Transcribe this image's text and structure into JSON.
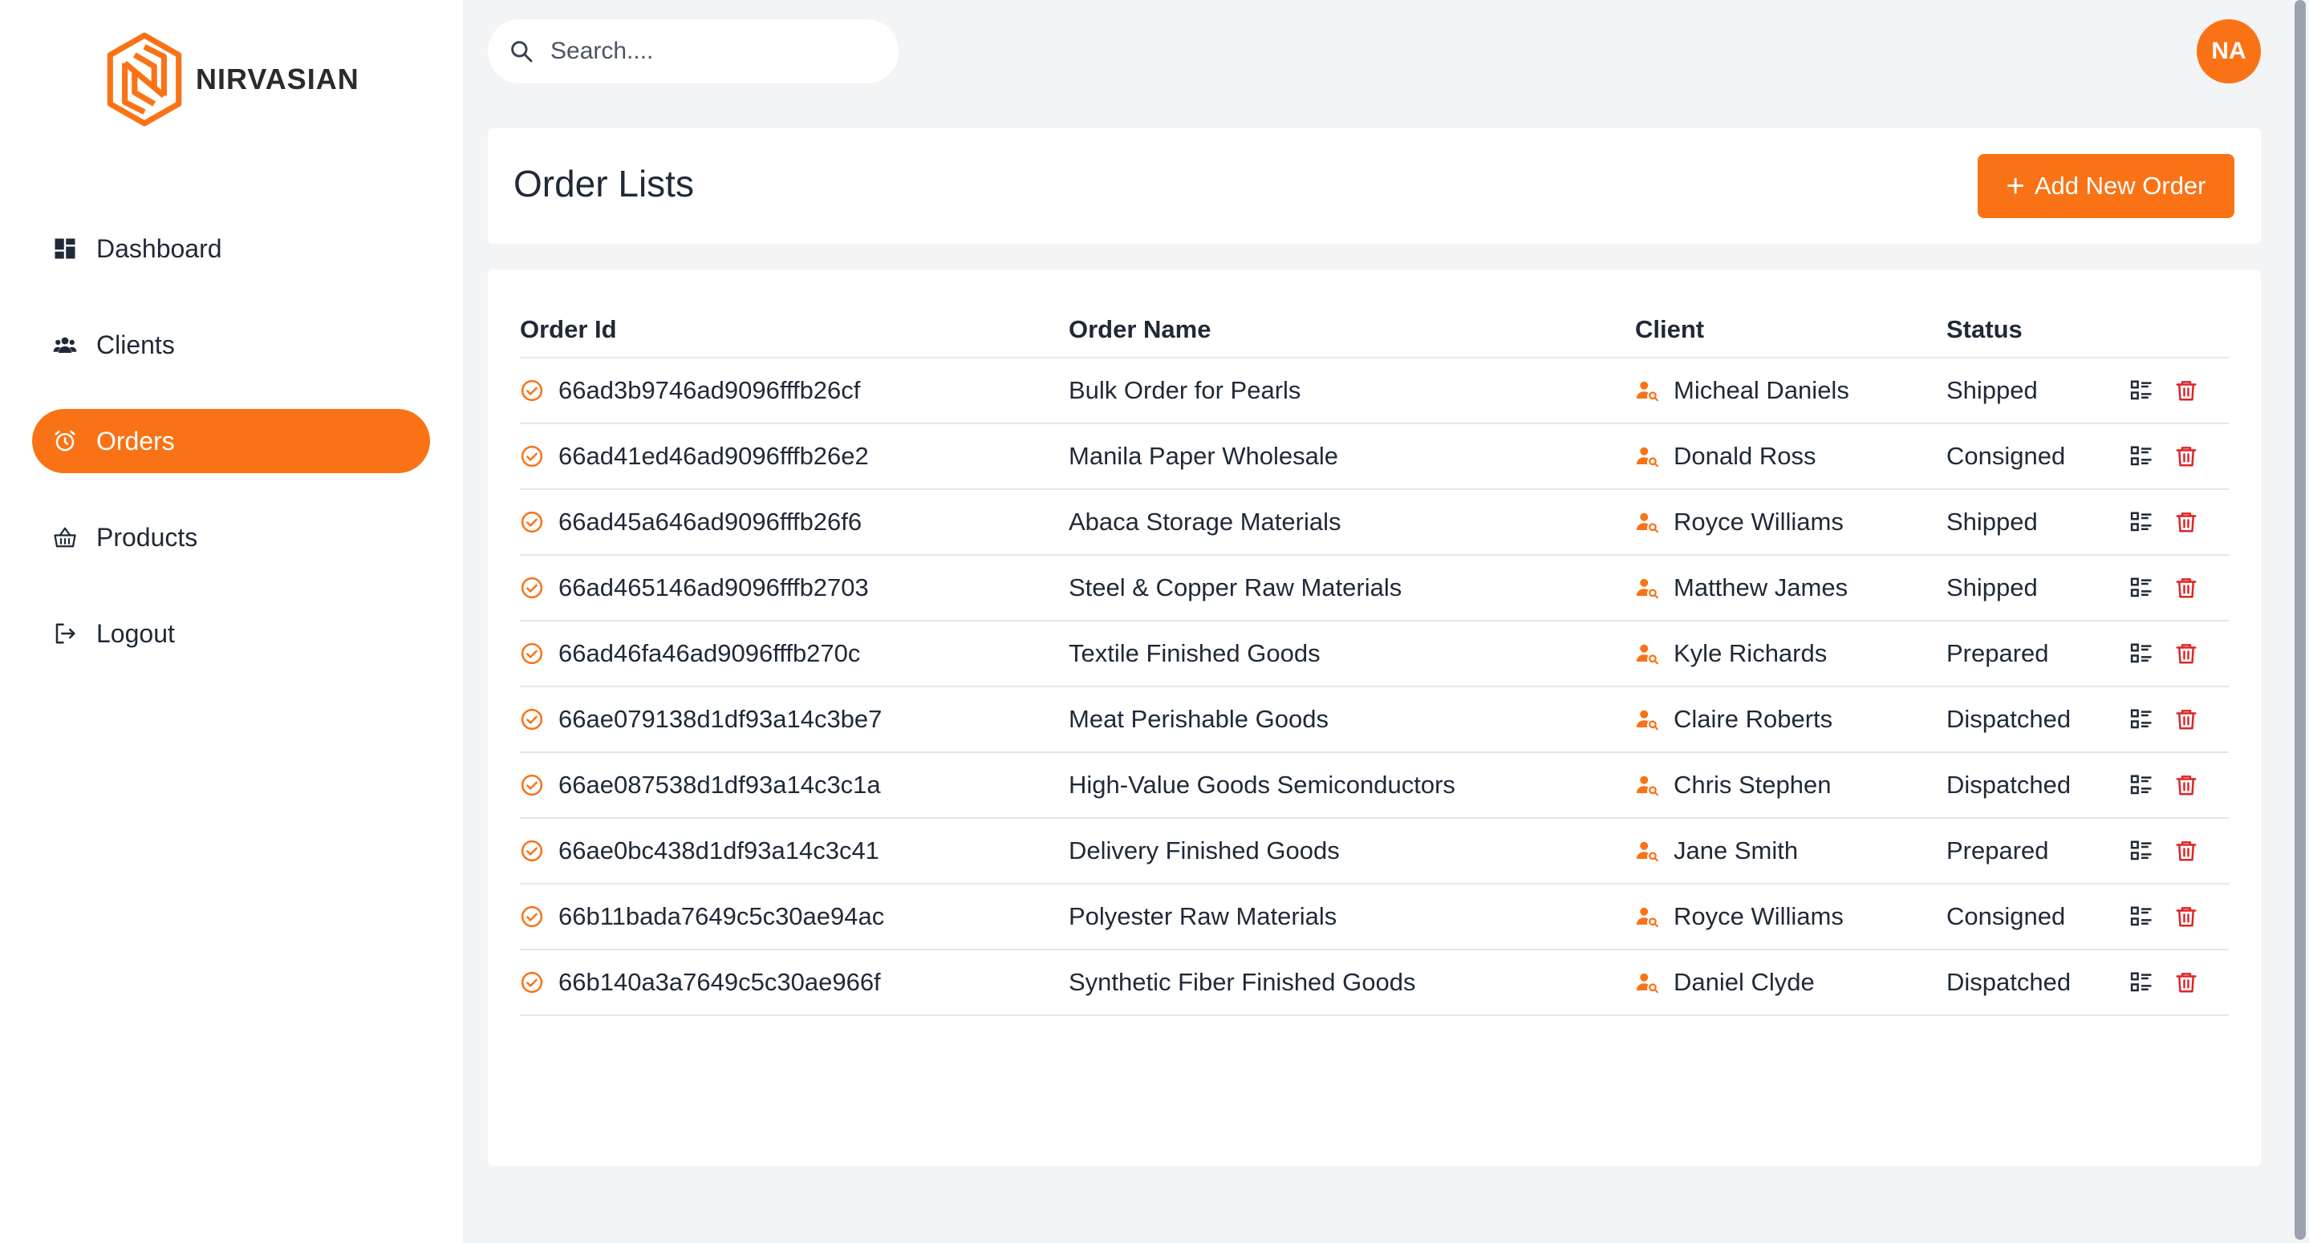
{
  "brand": {
    "name": "NIRVASIAN",
    "accent": "#f97316"
  },
  "sidebar": {
    "items": [
      {
        "label": "Dashboard",
        "icon": "grid-icon",
        "active": false
      },
      {
        "label": "Clients",
        "icon": "users-icon",
        "active": false
      },
      {
        "label": "Orders",
        "icon": "alarm-clock-icon",
        "active": true
      },
      {
        "label": "Products",
        "icon": "basket-icon",
        "active": false
      },
      {
        "label": "Logout",
        "icon": "logout-icon",
        "active": false
      }
    ]
  },
  "search": {
    "placeholder": "Search...."
  },
  "user": {
    "initials": "NA"
  },
  "header": {
    "title": "Order Lists",
    "add_label": "Add New Order"
  },
  "table": {
    "columns": [
      "Order Id",
      "Order Name",
      "Client",
      "Status"
    ],
    "rows": [
      {
        "id": "66ad3b9746ad9096fffb26cf",
        "name": "Bulk Order for Pearls",
        "client": "Micheal Daniels",
        "status": "Shipped"
      },
      {
        "id": "66ad41ed46ad9096fffb26e2",
        "name": "Manila Paper Wholesale",
        "client": "Donald Ross",
        "status": "Consigned"
      },
      {
        "id": "66ad45a646ad9096fffb26f6",
        "name": "Abaca Storage Materials",
        "client": "Royce Williams",
        "status": "Shipped"
      },
      {
        "id": "66ad465146ad9096fffb2703",
        "name": "Steel & Copper Raw Materials",
        "client": "Matthew James",
        "status": "Shipped"
      },
      {
        "id": "66ad46fa46ad9096fffb270c",
        "name": "Textile Finished Goods",
        "client": "Kyle Richards",
        "status": "Prepared"
      },
      {
        "id": "66ae079138d1df93a14c3be7",
        "name": "Meat Perishable Goods",
        "client": "Claire Roberts",
        "status": "Dispatched"
      },
      {
        "id": "66ae087538d1df93a14c3c1a",
        "name": "High-Value Goods Semiconductors",
        "client": "Chris Stephen",
        "status": "Dispatched"
      },
      {
        "id": "66ae0bc438d1df93a14c3c41",
        "name": "Delivery Finished Goods",
        "client": "Jane Smith",
        "status": "Prepared"
      },
      {
        "id": "66b11bada7649c5c30ae94ac",
        "name": "Polyester Raw Materials",
        "client": "Royce Williams",
        "status": "Consigned"
      },
      {
        "id": "66b140a3a7649c5c30ae966f",
        "name": "Synthetic Fiber Finished Goods",
        "client": "Daniel Clyde",
        "status": "Dispatched"
      }
    ]
  }
}
